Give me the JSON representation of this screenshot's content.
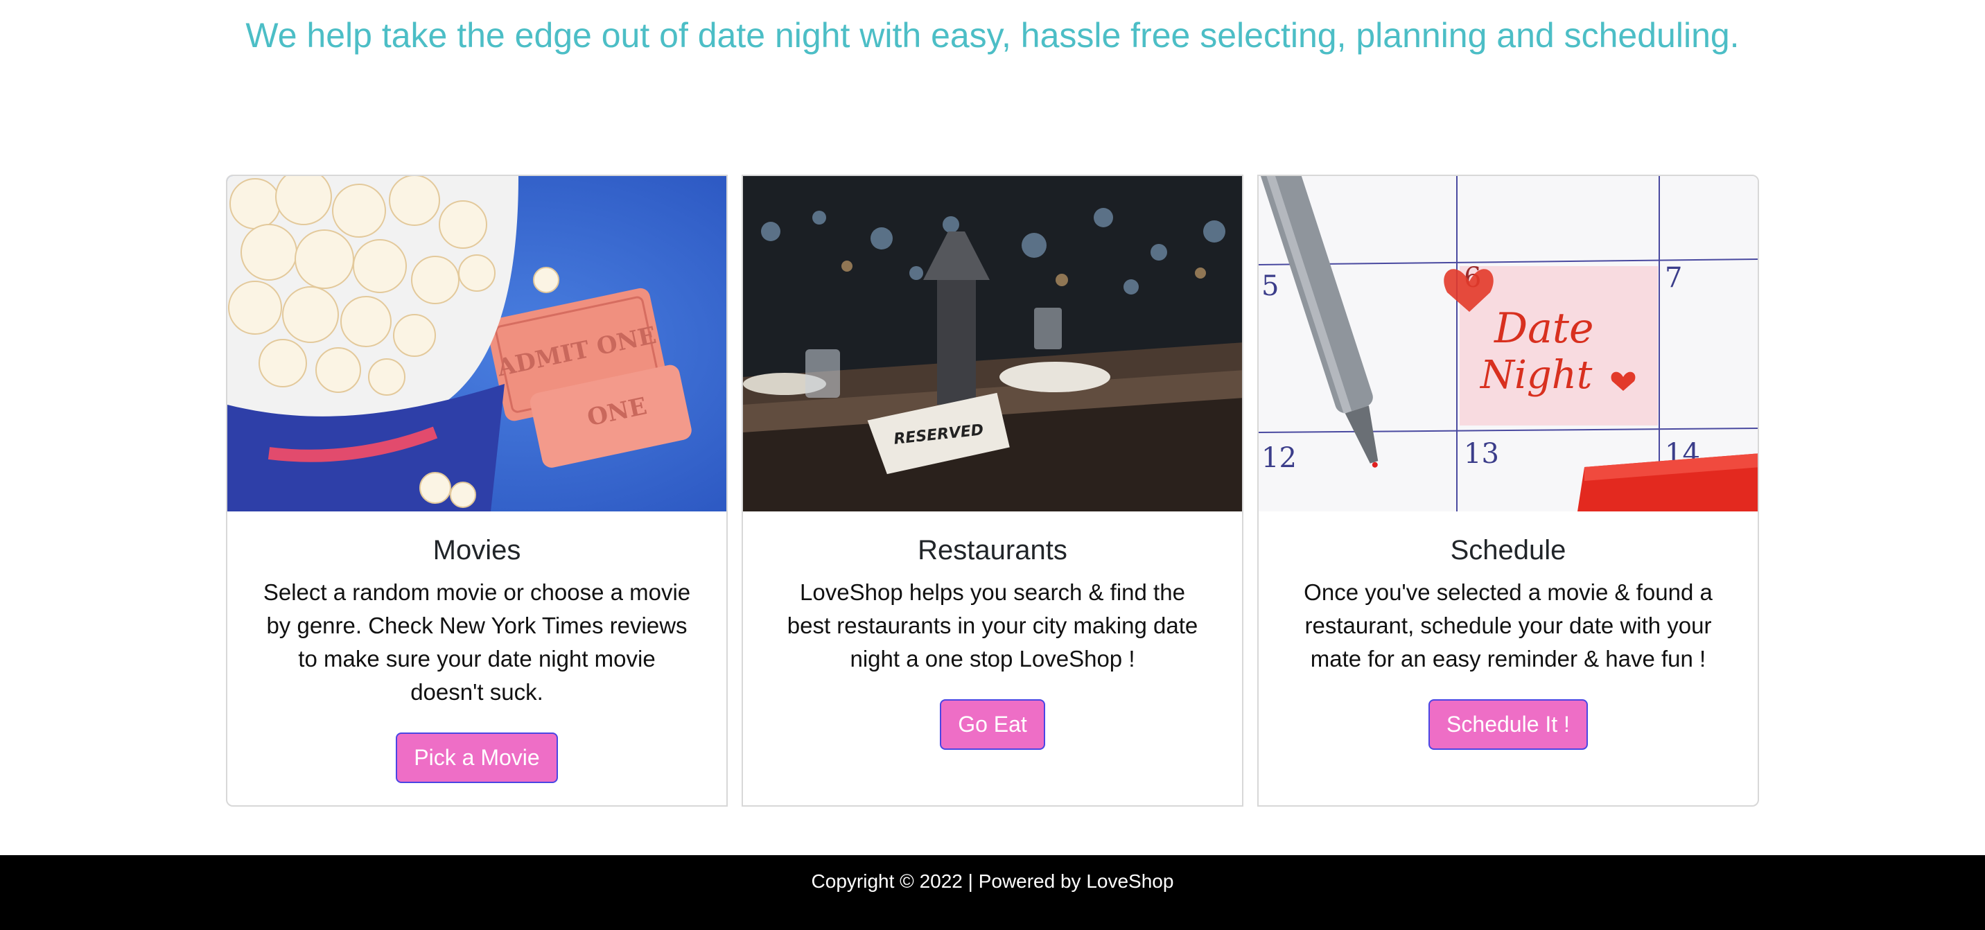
{
  "hero": {
    "tagline": "We help take the edge out of date night with easy, hassle free selecting, planning and scheduling."
  },
  "cards": [
    {
      "title": "Movies",
      "text": "Select a random movie or choose a movie by genre. Check New York Times reviews to make sure your date night movie doesn't suck.",
      "button": "Pick a Movie",
      "image_icon": "popcorn-tickets-image",
      "ticket_text_1": "ADMIT ONE",
      "ticket_text_2": "ONE"
    },
    {
      "title": "Restaurants",
      "text": "LoveShop helps you search & find the best restaurants in your city making date night a one stop LoveShop !",
      "button": "Go Eat",
      "image_icon": "restaurant-table-image",
      "sign_text": "RESERVED"
    },
    {
      "title": "Schedule",
      "text": "Once you've selected a movie & found a restaurant, schedule your date with your mate for an easy reminder & have fun !",
      "button": "Schedule It !",
      "image_icon": "calendar-date-night-image",
      "calendar_numbers": [
        "5",
        "6",
        "7",
        "12",
        "13",
        "14"
      ],
      "calendar_line_1": "Date",
      "calendar_line_2": "Night"
    }
  ],
  "footer": {
    "text": "Copyright © 2022 | Powered by LoveShop"
  },
  "colors": {
    "tagline": "#4cbec6",
    "button_bg": "#ee6ec6",
    "button_border": "#4a46e4",
    "footer_bg": "#000000"
  }
}
